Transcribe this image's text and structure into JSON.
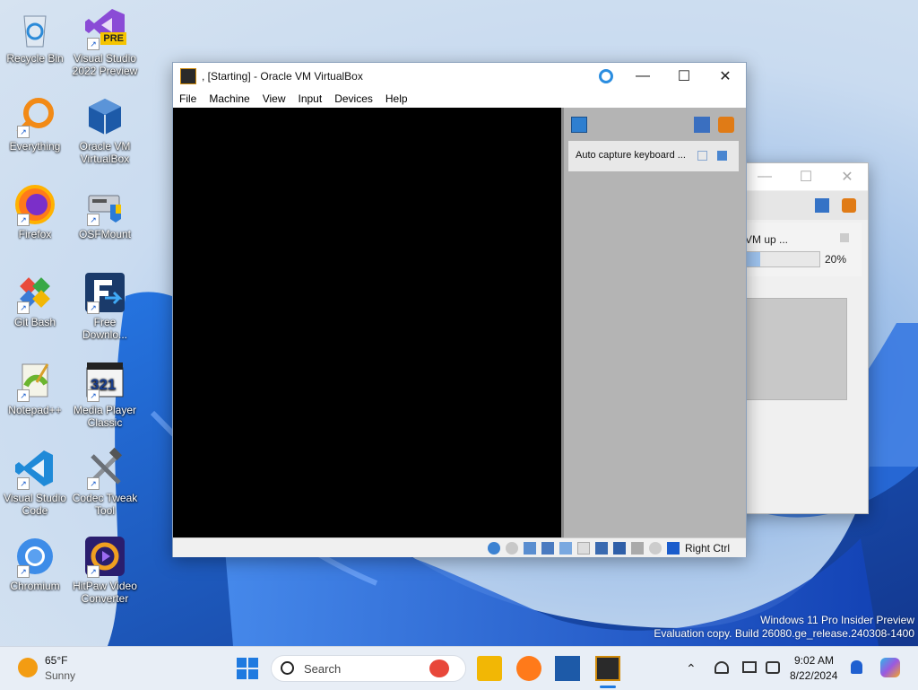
{
  "desktop": {
    "icons": [
      {
        "label1": "Recycle Bin",
        "label2": ""
      },
      {
        "label1": "Visual Studio",
        "label2": "2022 Preview"
      },
      {
        "label1": "Everything",
        "label2": ""
      },
      {
        "label1": "Oracle VM",
        "label2": "VirtualBox"
      },
      {
        "label1": "Firefox",
        "label2": ""
      },
      {
        "label1": "OSFMount",
        "label2": ""
      },
      {
        "label1": "Git Bash",
        "label2": ""
      },
      {
        "label1": "Free",
        "label2": "Downlo..."
      },
      {
        "label1": "Notepad++",
        "label2": ""
      },
      {
        "label1": "Media Player",
        "label2": "Classic"
      },
      {
        "label1": "Visual Studio",
        "label2": "Code"
      },
      {
        "label1": "Codec Tweak",
        "label2": "Tool"
      },
      {
        "label1": "Chromium",
        "label2": ""
      },
      {
        "label1": "HitPaw Video",
        "label2": "Converter"
      }
    ],
    "pre_badge": "PRE",
    "watermark_line1": "Windows 11 Pro Insider Preview",
    "watermark_line2": "Evaluation copy. Build 26080.ge_release.240308-1400"
  },
  "vbox": {
    "title": ", [Starting] - Oracle VM VirtualBox",
    "menu": [
      "File",
      "Machine",
      "View",
      "Input",
      "Devices",
      "Help"
    ],
    "notice_text": "Auto capture keyboard ...",
    "host_key": "Right Ctrl"
  },
  "bg_window": {
    "progress_text": "VM up ...",
    "progress_percent": "20%",
    "progress_value": 0.2
  },
  "taskbar": {
    "weather_temp": "65°F",
    "weather_desc": "Sunny",
    "search_placeholder": "Search",
    "time": "9:02 AM",
    "date": "8/22/2024"
  }
}
